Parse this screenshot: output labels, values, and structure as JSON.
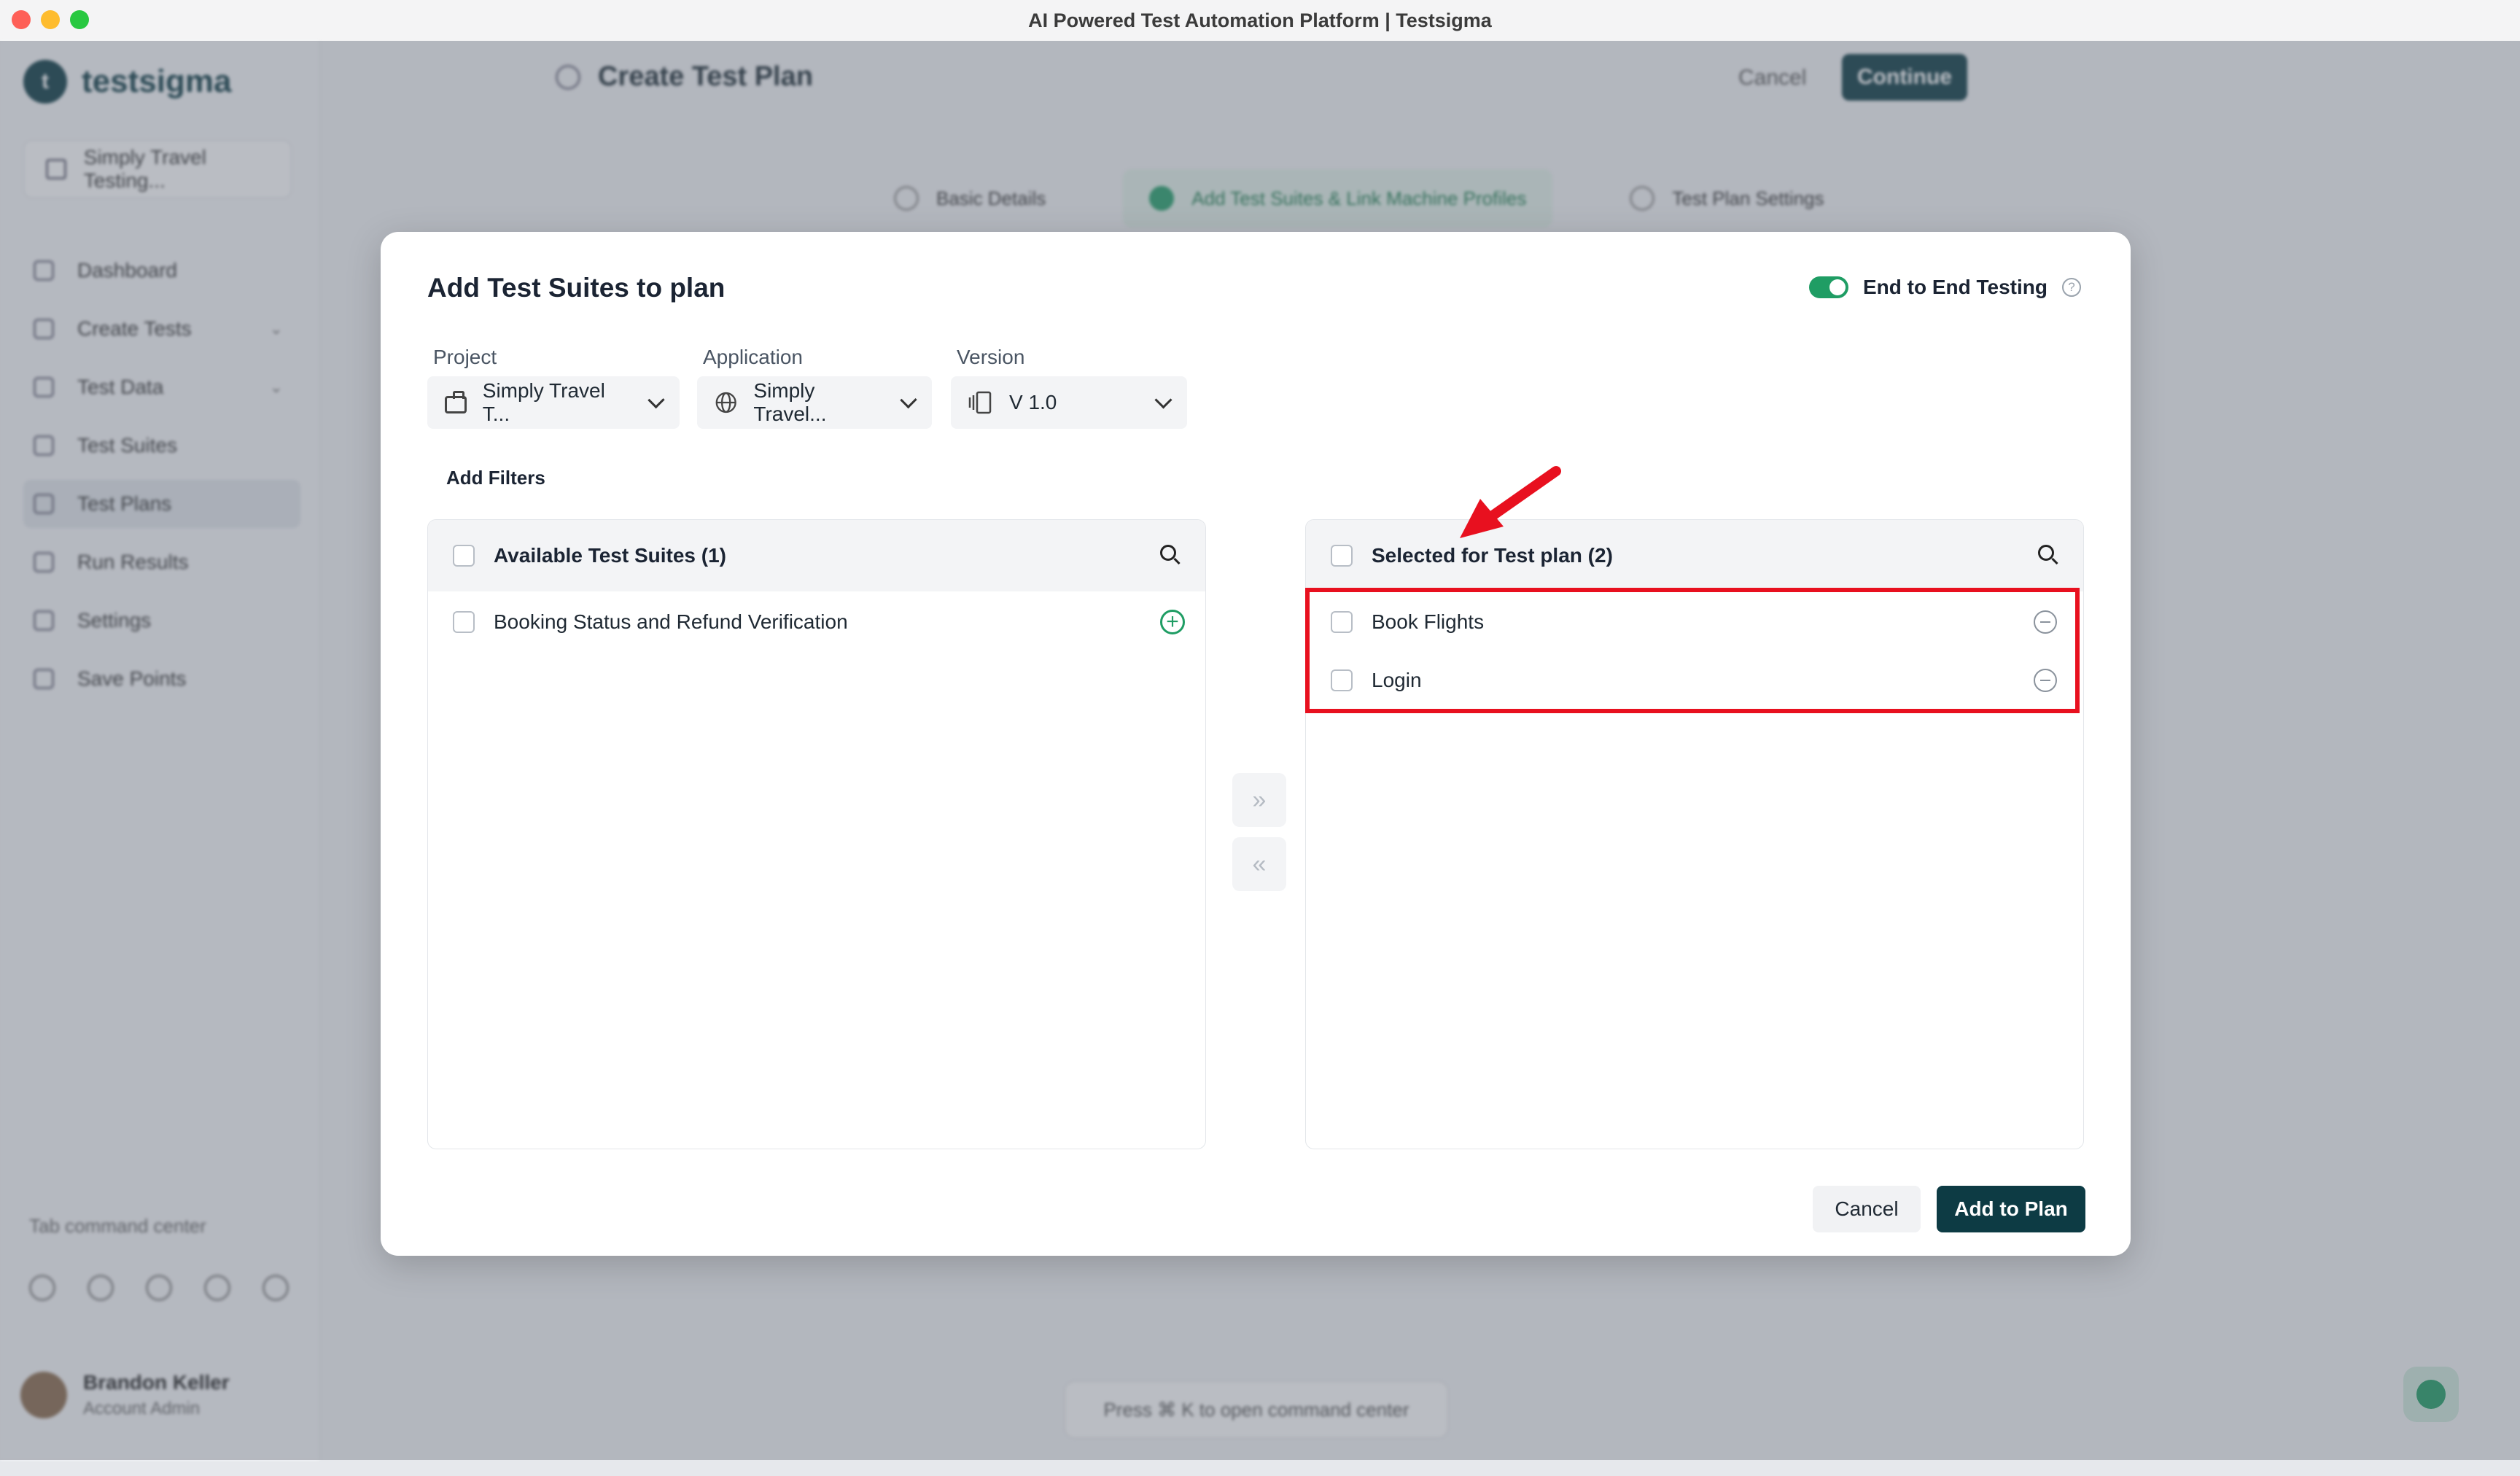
{
  "window": {
    "title": "AI Powered Test Automation Platform | Testsigma"
  },
  "background_app": {
    "brand": "testsigma",
    "workspace": "Simply Travel Testing...",
    "nav": [
      {
        "label": "Dashboard",
        "has_chevron": false
      },
      {
        "label": "Create Tests",
        "has_chevron": true
      },
      {
        "label": "Test Data",
        "has_chevron": true
      },
      {
        "label": "Test Suites",
        "has_chevron": false
      },
      {
        "label": "Test Plans",
        "has_chevron": false,
        "active": true
      },
      {
        "label": "Run Results",
        "has_chevron": false
      },
      {
        "label": "Settings",
        "has_chevron": false
      },
      {
        "label": "Save Points",
        "has_chevron": false
      }
    ],
    "command_hint": "Tab command center",
    "user": {
      "name": "Brandon Keller",
      "role": "Account Admin"
    },
    "page_title": "Create Test Plan",
    "cancel": "Cancel",
    "continue": "Continue",
    "steps": [
      "Basic Details",
      "Add Test Suites & Link Machine Profiles",
      "Test Plan Settings"
    ],
    "bottom_hint": "Press ⌘ K to open command center"
  },
  "modal": {
    "title": "Add Test Suites to plan",
    "e2e_label": "End to End Testing",
    "e2e_enabled": true,
    "fields": {
      "project": {
        "label": "Project",
        "value": "Simply Travel T..."
      },
      "application": {
        "label": "Application",
        "value": "Simply Travel..."
      },
      "version": {
        "label": "Version",
        "value": "V 1.0"
      }
    },
    "add_filters": "Add Filters",
    "available": {
      "header": "Available Test Suites (1)",
      "items": [
        "Booking Status and Refund Verification"
      ]
    },
    "selected": {
      "header": "Selected for Test plan (2)",
      "items": [
        "Book Flights",
        "Login"
      ]
    },
    "move_right": "»",
    "move_left": "«",
    "cancel": "Cancel",
    "add_to_plan": "Add to Plan"
  },
  "colors": {
    "accent_green": "#1f9d64",
    "primary_dark": "#0d3b44",
    "annotation_red": "#e8101f"
  }
}
